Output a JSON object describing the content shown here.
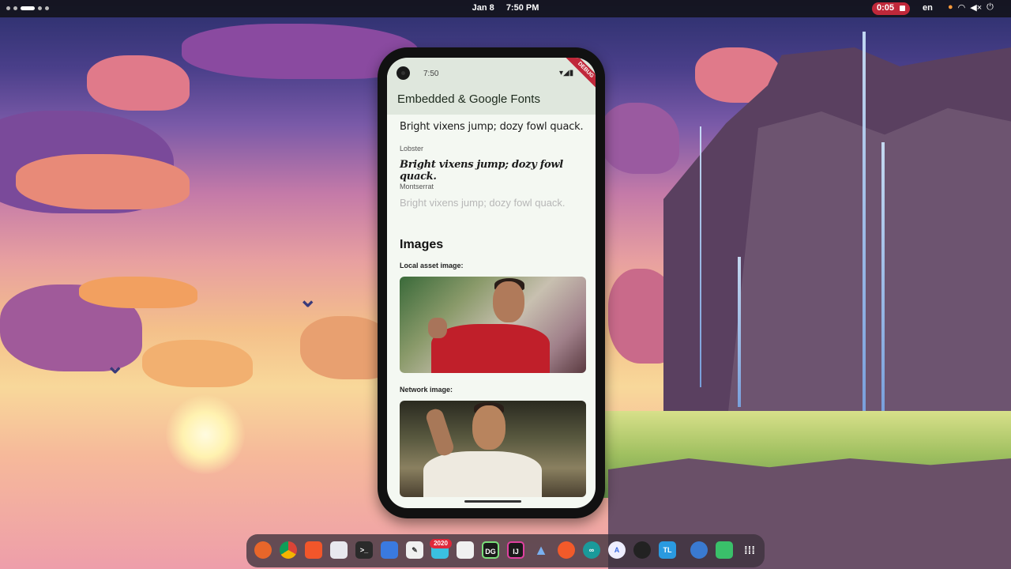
{
  "topbar": {
    "date": "Jan 8",
    "time": "7:50 PM",
    "recording_time": "0:05",
    "language": "en"
  },
  "phone": {
    "status_time": "7:50",
    "debug_banner": "DEBUG",
    "app_title": "Embedded & Google Fonts",
    "font_samples": [
      {
        "label": "",
        "text": "Bright vixens jump; dozy fowl quack."
      },
      {
        "label": "Lobster",
        "text": "Bright vixens jump; dozy fowl quack."
      },
      {
        "label": "Montserrat",
        "text": "Bright vixens jump; dozy fowl quack."
      }
    ],
    "images_heading": "Images",
    "local_image_label": "Local asset image:",
    "network_image_label": "Network image:"
  },
  "dock": {
    "badge": "2020",
    "icons": [
      "firefox-icon",
      "chrome-icon",
      "brave-icon",
      "files-icon",
      "terminal-icon",
      "document-icon",
      "text-editor-icon",
      "app-store-icon",
      "briefcase-icon",
      "datagrip-icon",
      "intellij-icon",
      "android-studio-icon",
      "pen-icon",
      "arduino-icon",
      "vscode-a-icon",
      "gamepad-icon",
      "tl-icon",
      "flutter-icon",
      "android-icon",
      "app-grid-icon"
    ],
    "labels": {
      "datagrip": "DG",
      "intellij": "IJ",
      "tl": "TL"
    },
    "colors": {
      "accent": "#c0283a",
      "dock_bg": "#3c323c"
    }
  }
}
